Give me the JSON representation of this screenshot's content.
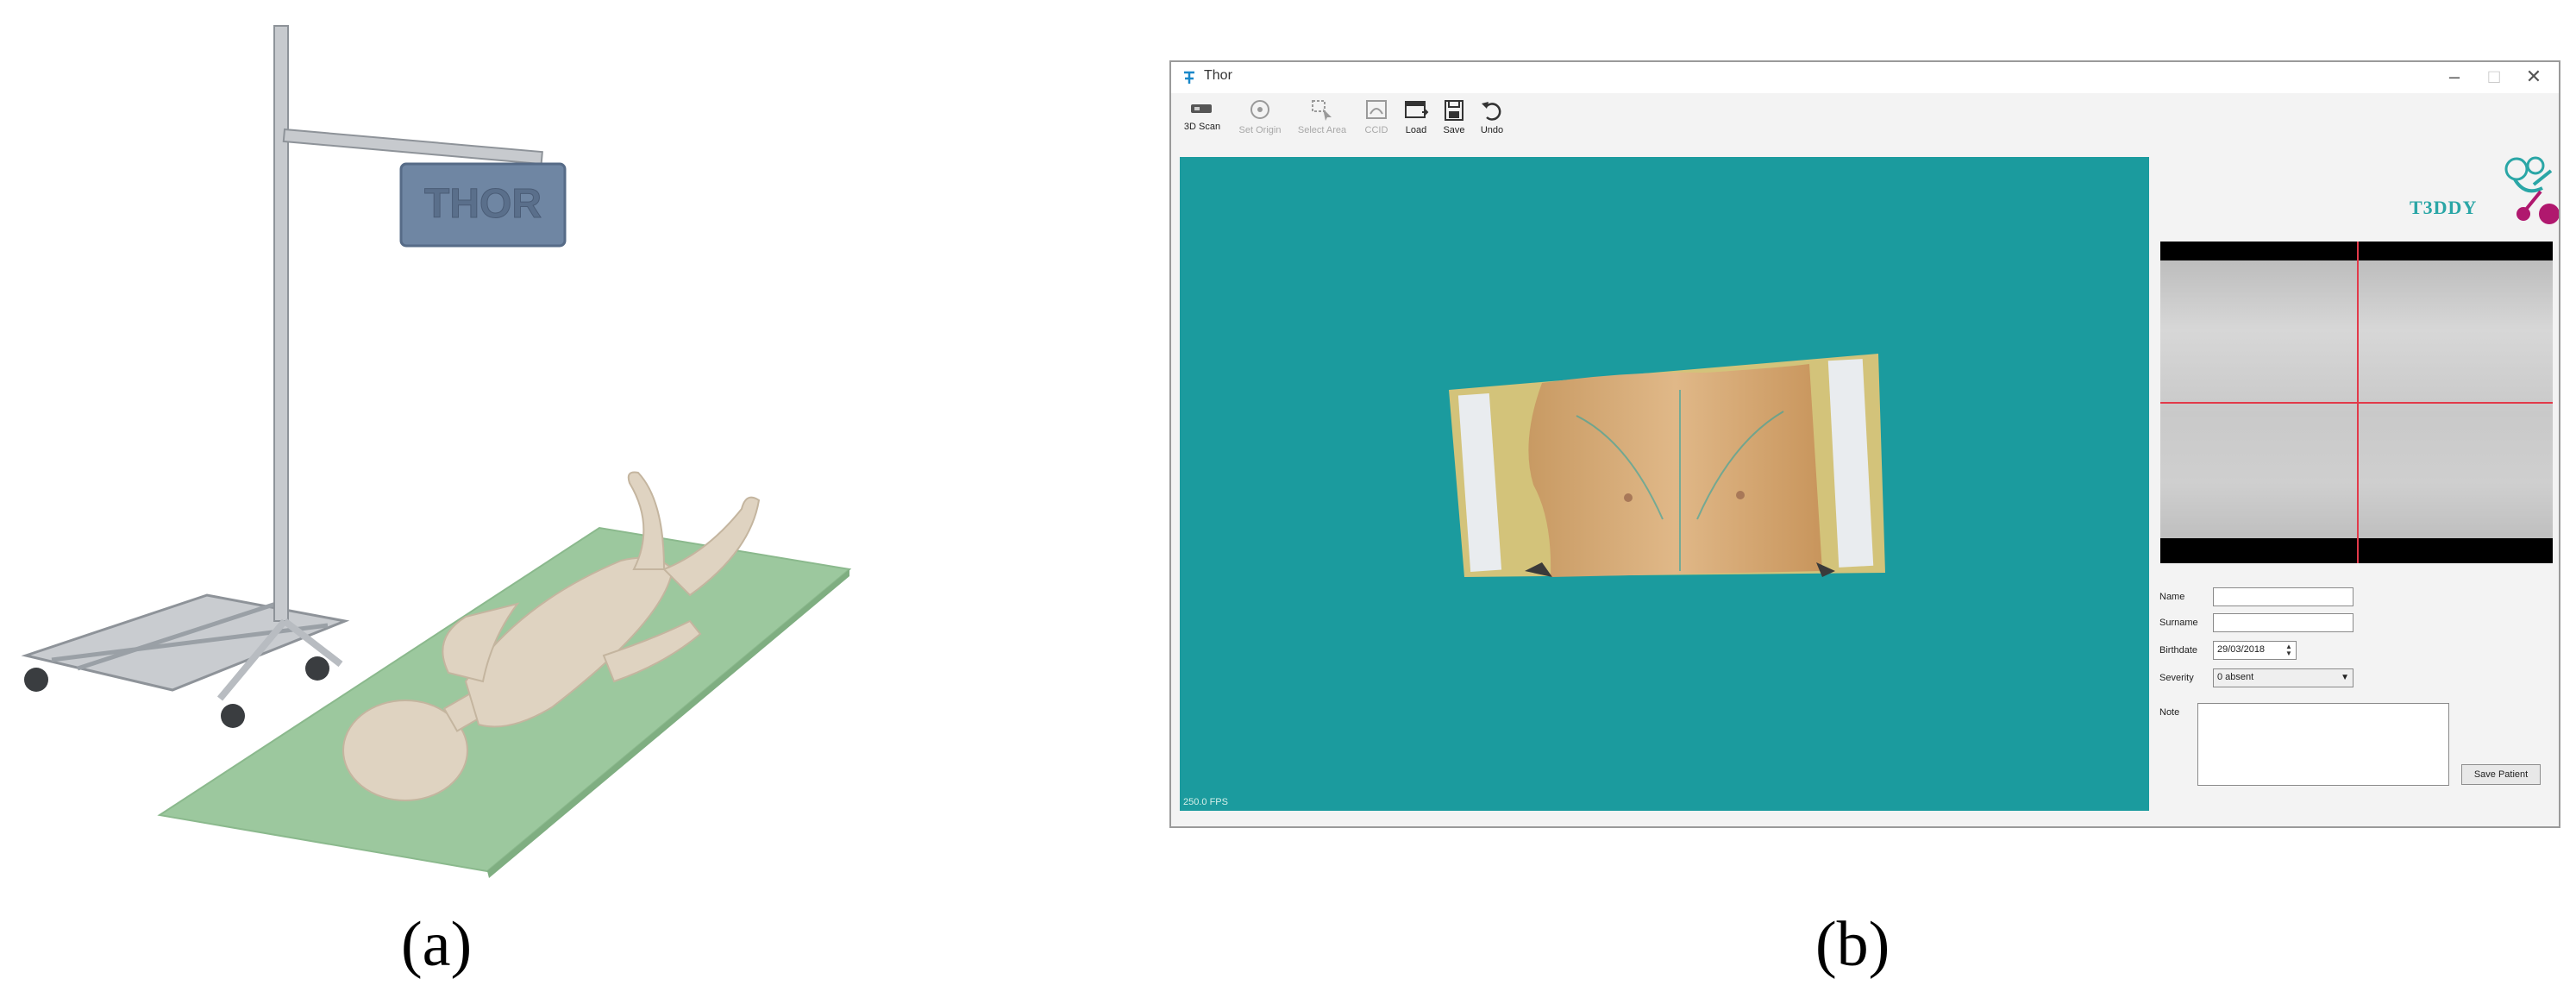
{
  "figure": {
    "label_a": "(a)",
    "label_b": "(b)",
    "device_brand": "THOR"
  },
  "window": {
    "title": "Thor",
    "controls": {
      "minimize": "–",
      "maximize": "□",
      "close": "✕"
    }
  },
  "toolbar": {
    "items": [
      {
        "label": "3D Scan",
        "icon": "scanner-icon",
        "enabled": true
      },
      {
        "label": "Set Origin",
        "icon": "target-icon",
        "enabled": false
      },
      {
        "label": "Select Area",
        "icon": "select-area-icon",
        "enabled": false
      },
      {
        "label": "CCID",
        "icon": "ccid-icon",
        "enabled": false
      },
      {
        "label": "Load",
        "icon": "load-icon",
        "enabled": true
      },
      {
        "label": "Save",
        "icon": "save-icon",
        "enabled": true
      },
      {
        "label": "Undo",
        "icon": "undo-icon",
        "enabled": true
      }
    ]
  },
  "viewport": {
    "fps_text": "250.0 FPS"
  },
  "logo": {
    "text": "T3DDY"
  },
  "form": {
    "name_label": "Name",
    "name_value": "",
    "surname_label": "Surname",
    "surname_value": "",
    "birthdate_label": "Birthdate",
    "birthdate_value": "29/03/2018",
    "severity_label": "Severity",
    "severity_value": "0 absent",
    "note_label": "Note",
    "note_value": "",
    "save_patient_label": "Save Patient"
  },
  "colors": {
    "viewport_bg": "#1b9b9e",
    "crosshair": "#e23a4a",
    "mat": "#9cc89e",
    "device_box": "#6f86a3",
    "logo_teal": "#2aa6a6",
    "logo_magenta": "#b0186e"
  }
}
